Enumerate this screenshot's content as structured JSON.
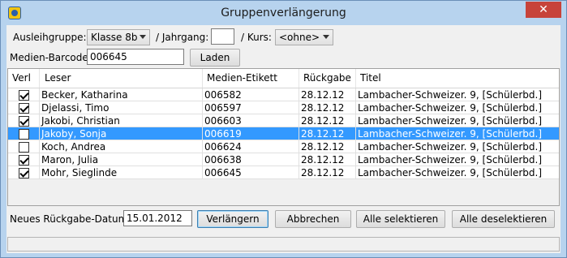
{
  "window": {
    "title": "Gruppenverlängerung",
    "close_symbol": "✕"
  },
  "filters": {
    "group_label": "Ausleihgruppe:",
    "group_value": "Klasse 8b",
    "year_label": "/ Jahrgang:",
    "year_value": "",
    "course_label": "/ Kurs:",
    "course_value": "<ohne>",
    "barcode_label": "Medien-Barcode:",
    "barcode_value": "006645",
    "load_button": "Laden"
  },
  "table": {
    "columns": [
      "Verl",
      "Leser",
      "Medien-Etikett",
      "Rückgabe",
      "Titel"
    ],
    "rows": [
      {
        "checked": true,
        "reader": "Becker, Katharina",
        "label": "006582",
        "due": "28.12.12",
        "title": "Lambacher-Schweizer. 9, [Schülerbd.]"
      },
      {
        "checked": true,
        "reader": "Djelassi, Timo",
        "label": "006597",
        "due": "28.12.12",
        "title": "Lambacher-Schweizer. 9, [Schülerbd.]"
      },
      {
        "checked": true,
        "reader": "Jakobi, Christian",
        "label": "006603",
        "due": "28.12.12",
        "title": "Lambacher-Schweizer. 9, [Schülerbd.]"
      },
      {
        "checked": false,
        "reader": "Jakoby, Sonja",
        "label": "006619",
        "due": "28.12.12",
        "title": "Lambacher-Schweizer. 9, [Schülerbd.]",
        "selected": true
      },
      {
        "checked": false,
        "reader": "Koch, Andrea",
        "label": "006624",
        "due": "28.12.12",
        "title": "Lambacher-Schweizer. 9, [Schülerbd.]"
      },
      {
        "checked": true,
        "reader": "Maron, Julia",
        "label": "006638",
        "due": "28.12.12",
        "title": "Lambacher-Schweizer. 9, [Schülerbd.]"
      },
      {
        "checked": true,
        "reader": "Mohr, Sieglinde",
        "label": "006645",
        "due": "28.12.12",
        "title": "Lambacher-Schweizer. 9, [Schülerbd.]"
      }
    ]
  },
  "footer": {
    "date_label": "Neues Rückgabe-Datum:",
    "date_value": "15.01.2012",
    "extend_button": "Verlängern",
    "cancel_button": "Abbrechen",
    "select_all_button": "Alle selektieren",
    "deselect_all_button": "Alle deselektieren"
  },
  "colors": {
    "selection": "#3399ff",
    "frame": "#b7d3ee",
    "close": "#c7433a"
  }
}
